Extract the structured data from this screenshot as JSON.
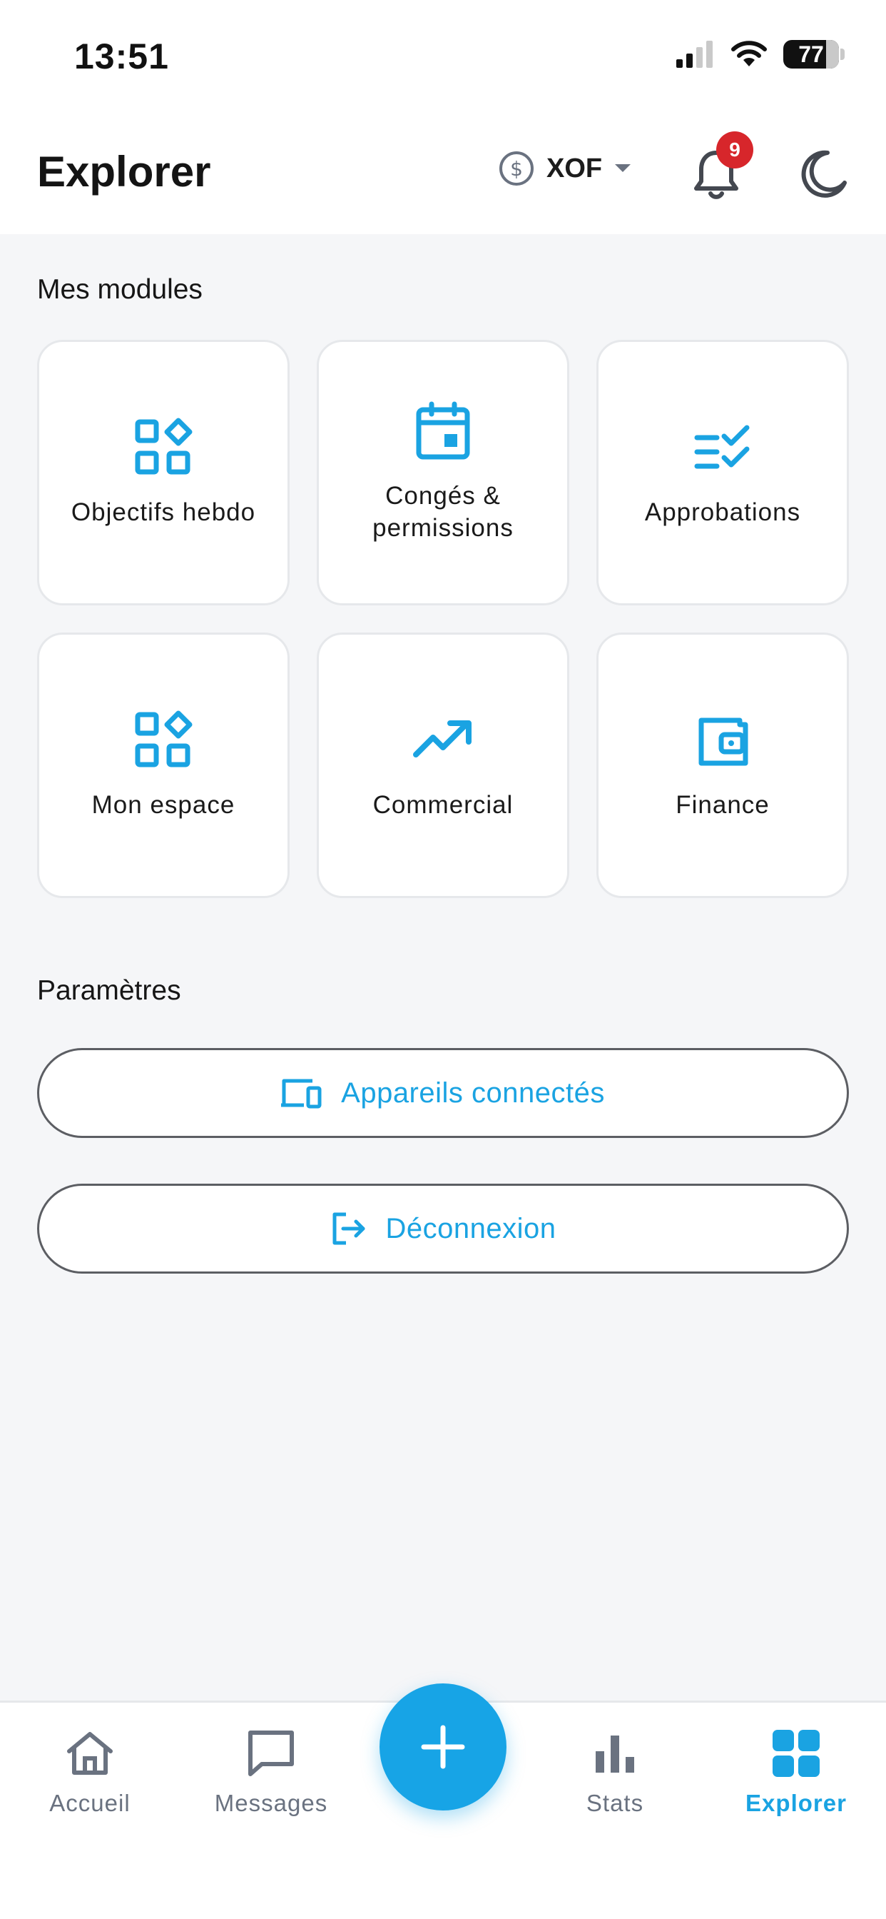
{
  "status_bar": {
    "time": "13:51",
    "battery": "77"
  },
  "header": {
    "title": "Explorer",
    "currency": "XOF",
    "notification_count": "9"
  },
  "modules": {
    "title": "Mes modules",
    "items": [
      {
        "label": "Objectifs hebdo",
        "icon": "widgets-icon"
      },
      {
        "label": "Congés & permissions",
        "icon": "calendar-icon"
      },
      {
        "label": "Approbations",
        "icon": "checklist-icon"
      },
      {
        "label": "Mon espace",
        "icon": "widgets-icon"
      },
      {
        "label": "Commercial",
        "icon": "trending-up-icon"
      },
      {
        "label": "Finance",
        "icon": "wallet-icon"
      }
    ]
  },
  "settings": {
    "title": "Paramètres",
    "connected_devices": "Appareils connectés",
    "logout": "Déconnexion"
  },
  "bottom_nav": {
    "items": [
      {
        "label": "Accueil",
        "icon": "home-icon"
      },
      {
        "label": "Messages",
        "icon": "message-icon"
      },
      {
        "label": "Stats",
        "icon": "bar-chart-icon"
      },
      {
        "label": "Explorer",
        "icon": "grid-icon"
      }
    ]
  },
  "colors": {
    "accent": "#1aa3e2",
    "badge": "#d7262b",
    "background": "#f5f6f8",
    "nav_inactive": "#6a7280"
  }
}
